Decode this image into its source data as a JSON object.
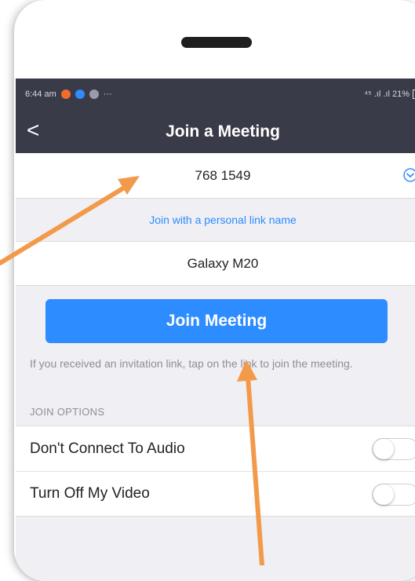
{
  "status_bar": {
    "time": "6:44 am",
    "more": "···",
    "signal": "⁴⁵ .ıl .ıl 21%"
  },
  "header": {
    "back": "<",
    "title": "Join a Meeting"
  },
  "meeting_id": {
    "value": "768 1549"
  },
  "personal_link": "Join with a personal link name",
  "display_name": "Galaxy M20",
  "join_button": "Join Meeting",
  "hint": "If you received an invitation link, tap on the link to join the meeting.",
  "join_options": {
    "label": "JOIN OPTIONS",
    "items": [
      {
        "label": "Don't Connect To Audio",
        "on": false
      },
      {
        "label": "Turn Off My Video",
        "on": false
      }
    ]
  },
  "colors": {
    "accent": "#2d8cff",
    "header": "#3a3b48",
    "annotation_arrow": "#f39a4a"
  }
}
